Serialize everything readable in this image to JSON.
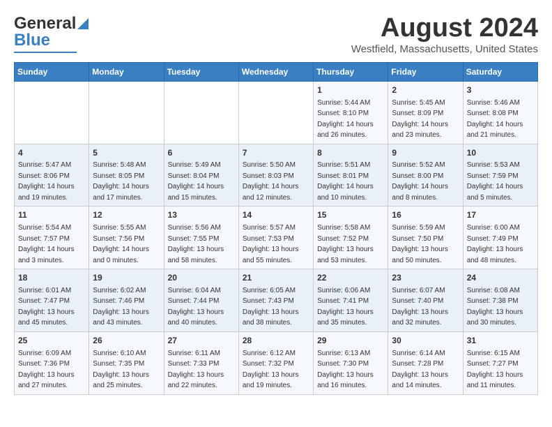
{
  "header": {
    "logo_general": "General",
    "logo_blue": "Blue",
    "month_year": "August 2024",
    "location": "Westfield, Massachusetts, United States"
  },
  "weekdays": [
    "Sunday",
    "Monday",
    "Tuesday",
    "Wednesday",
    "Thursday",
    "Friday",
    "Saturday"
  ],
  "weeks": [
    [
      {
        "day": "",
        "info": ""
      },
      {
        "day": "",
        "info": ""
      },
      {
        "day": "",
        "info": ""
      },
      {
        "day": "",
        "info": ""
      },
      {
        "day": "1",
        "info": "Sunrise: 5:44 AM\nSunset: 8:10 PM\nDaylight: 14 hours\nand 26 minutes."
      },
      {
        "day": "2",
        "info": "Sunrise: 5:45 AM\nSunset: 8:09 PM\nDaylight: 14 hours\nand 23 minutes."
      },
      {
        "day": "3",
        "info": "Sunrise: 5:46 AM\nSunset: 8:08 PM\nDaylight: 14 hours\nand 21 minutes."
      }
    ],
    [
      {
        "day": "4",
        "info": "Sunrise: 5:47 AM\nSunset: 8:06 PM\nDaylight: 14 hours\nand 19 minutes."
      },
      {
        "day": "5",
        "info": "Sunrise: 5:48 AM\nSunset: 8:05 PM\nDaylight: 14 hours\nand 17 minutes."
      },
      {
        "day": "6",
        "info": "Sunrise: 5:49 AM\nSunset: 8:04 PM\nDaylight: 14 hours\nand 15 minutes."
      },
      {
        "day": "7",
        "info": "Sunrise: 5:50 AM\nSunset: 8:03 PM\nDaylight: 14 hours\nand 12 minutes."
      },
      {
        "day": "8",
        "info": "Sunrise: 5:51 AM\nSunset: 8:01 PM\nDaylight: 14 hours\nand 10 minutes."
      },
      {
        "day": "9",
        "info": "Sunrise: 5:52 AM\nSunset: 8:00 PM\nDaylight: 14 hours\nand 8 minutes."
      },
      {
        "day": "10",
        "info": "Sunrise: 5:53 AM\nSunset: 7:59 PM\nDaylight: 14 hours\nand 5 minutes."
      }
    ],
    [
      {
        "day": "11",
        "info": "Sunrise: 5:54 AM\nSunset: 7:57 PM\nDaylight: 14 hours\nand 3 minutes."
      },
      {
        "day": "12",
        "info": "Sunrise: 5:55 AM\nSunset: 7:56 PM\nDaylight: 14 hours\nand 0 minutes."
      },
      {
        "day": "13",
        "info": "Sunrise: 5:56 AM\nSunset: 7:55 PM\nDaylight: 13 hours\nand 58 minutes."
      },
      {
        "day": "14",
        "info": "Sunrise: 5:57 AM\nSunset: 7:53 PM\nDaylight: 13 hours\nand 55 minutes."
      },
      {
        "day": "15",
        "info": "Sunrise: 5:58 AM\nSunset: 7:52 PM\nDaylight: 13 hours\nand 53 minutes."
      },
      {
        "day": "16",
        "info": "Sunrise: 5:59 AM\nSunset: 7:50 PM\nDaylight: 13 hours\nand 50 minutes."
      },
      {
        "day": "17",
        "info": "Sunrise: 6:00 AM\nSunset: 7:49 PM\nDaylight: 13 hours\nand 48 minutes."
      }
    ],
    [
      {
        "day": "18",
        "info": "Sunrise: 6:01 AM\nSunset: 7:47 PM\nDaylight: 13 hours\nand 45 minutes."
      },
      {
        "day": "19",
        "info": "Sunrise: 6:02 AM\nSunset: 7:46 PM\nDaylight: 13 hours\nand 43 minutes."
      },
      {
        "day": "20",
        "info": "Sunrise: 6:04 AM\nSunset: 7:44 PM\nDaylight: 13 hours\nand 40 minutes."
      },
      {
        "day": "21",
        "info": "Sunrise: 6:05 AM\nSunset: 7:43 PM\nDaylight: 13 hours\nand 38 minutes."
      },
      {
        "day": "22",
        "info": "Sunrise: 6:06 AM\nSunset: 7:41 PM\nDaylight: 13 hours\nand 35 minutes."
      },
      {
        "day": "23",
        "info": "Sunrise: 6:07 AM\nSunset: 7:40 PM\nDaylight: 13 hours\nand 32 minutes."
      },
      {
        "day": "24",
        "info": "Sunrise: 6:08 AM\nSunset: 7:38 PM\nDaylight: 13 hours\nand 30 minutes."
      }
    ],
    [
      {
        "day": "25",
        "info": "Sunrise: 6:09 AM\nSunset: 7:36 PM\nDaylight: 13 hours\nand 27 minutes."
      },
      {
        "day": "26",
        "info": "Sunrise: 6:10 AM\nSunset: 7:35 PM\nDaylight: 13 hours\nand 25 minutes."
      },
      {
        "day": "27",
        "info": "Sunrise: 6:11 AM\nSunset: 7:33 PM\nDaylight: 13 hours\nand 22 minutes."
      },
      {
        "day": "28",
        "info": "Sunrise: 6:12 AM\nSunset: 7:32 PM\nDaylight: 13 hours\nand 19 minutes."
      },
      {
        "day": "29",
        "info": "Sunrise: 6:13 AM\nSunset: 7:30 PM\nDaylight: 13 hours\nand 16 minutes."
      },
      {
        "day": "30",
        "info": "Sunrise: 6:14 AM\nSunset: 7:28 PM\nDaylight: 13 hours\nand 14 minutes."
      },
      {
        "day": "31",
        "info": "Sunrise: 6:15 AM\nSunset: 7:27 PM\nDaylight: 13 hours\nand 11 minutes."
      }
    ]
  ]
}
